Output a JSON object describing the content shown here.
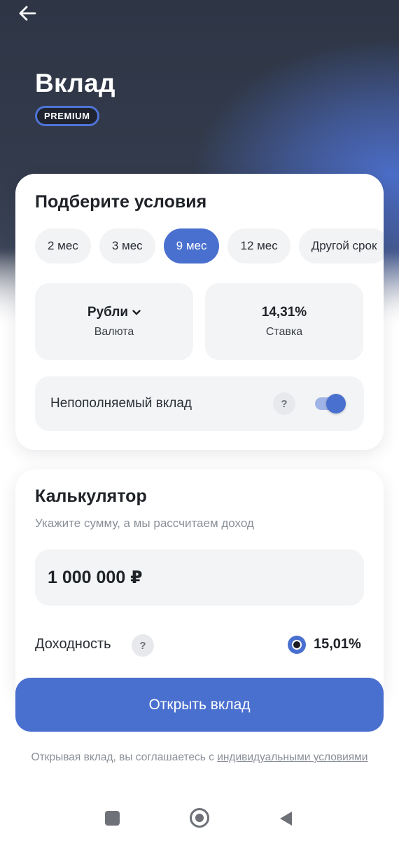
{
  "header": {
    "title": "Вклад",
    "badge": "PREMIUM"
  },
  "conditions": {
    "title": "Подберите условия",
    "terms": [
      "2 мес",
      "3 мес",
      "9 мес",
      "12 мес",
      "Другой срок"
    ],
    "selected_term": "9 мес",
    "currency": {
      "value": "Рубли",
      "label": "Валюта"
    },
    "rate": {
      "value": "14,31%",
      "label": "Ставка"
    },
    "non_replenishable": {
      "label": "Непополняемый вклад",
      "help": "?",
      "enabled": true
    }
  },
  "calculator": {
    "title": "Калькулятор",
    "subtitle": "Укажите сумму, а мы рассчитаем доход",
    "amount": "1 000 000 ₽",
    "yield_label": "Доходность",
    "yield_help": "?",
    "yield_value": "15,01%"
  },
  "actions": {
    "open_label": "Открыть вклад"
  },
  "disclaimer": {
    "text": "Открывая вклад, вы соглашаетесь с ",
    "link": "индивидуальными условиями"
  },
  "colors": {
    "accent": "#4a70cf",
    "hero_dark": "#2e3646"
  },
  "icons": {
    "back": "arrow-left-icon",
    "currency_dropdown": "chevron-down-icon",
    "nav_recent": "square-icon",
    "nav_home": "circle-icon",
    "nav_back": "triangle-left-icon"
  }
}
